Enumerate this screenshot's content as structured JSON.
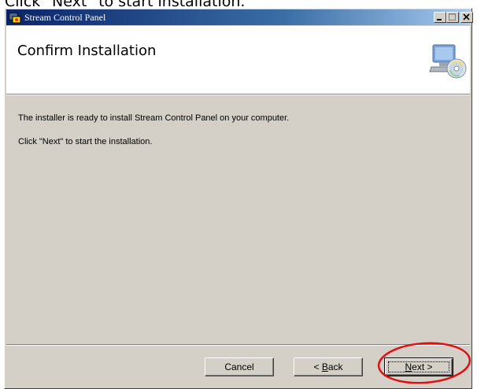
{
  "caption": "Click \"Next\" to start installation.",
  "window": {
    "title": "Stream Control Panel",
    "controls": {
      "minimize_icon": "minimize-icon",
      "maximize_icon": "maximize-icon",
      "close_icon": "close-icon"
    }
  },
  "header": {
    "title": "Confirm Installation",
    "icon": "computer-cd-icon"
  },
  "body": {
    "line1": "The installer is ready to install Stream Control Panel on your computer.",
    "line2": "Click \"Next\" to start the installation."
  },
  "buttons": {
    "cancel": "Cancel",
    "back_accel": "B",
    "back_rest": "ack",
    "back_prefix": "< ",
    "next_accel": "N",
    "next_rest": "ext >"
  },
  "colors": {
    "title_gradient_start": "#0a246a",
    "title_gradient_end": "#a6caf0",
    "dialog_face": "#d4d0c8",
    "highlight_oval": "#e01010"
  }
}
